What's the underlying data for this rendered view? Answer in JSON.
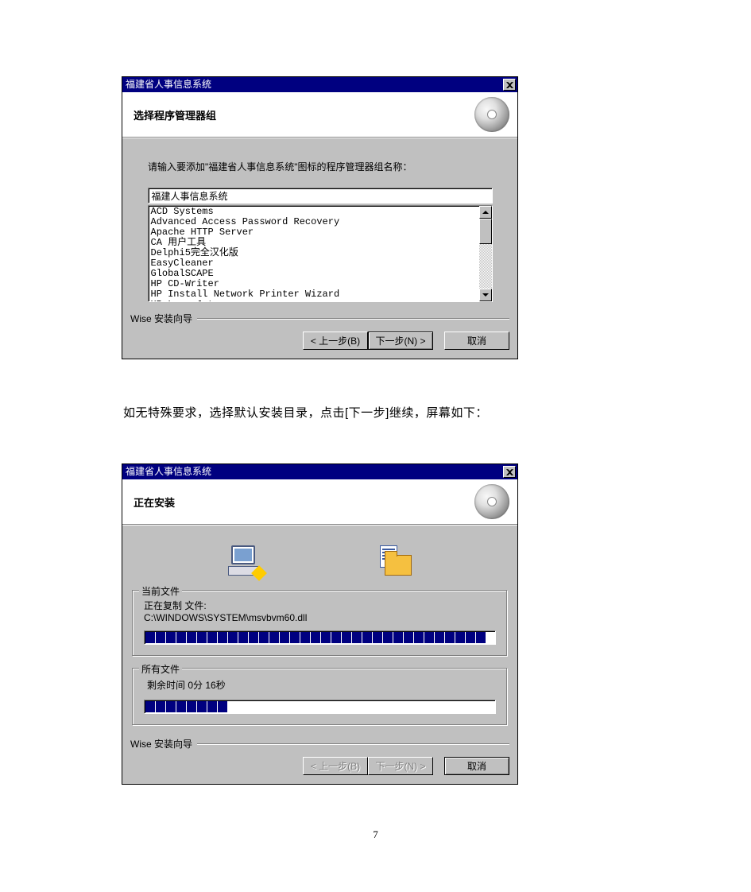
{
  "dialog1": {
    "title": "福建省人事信息系统",
    "header": "选择程序管理器组",
    "instruction": "请输入要添加\"福建省人事信息系统\"图标的程序管理器组名称：",
    "input_value": "福建人事信息系统",
    "list": [
      "ACD Systems",
      "Advanced Access Password Recovery",
      "Apache HTTP Server",
      "CA 用户工具",
      "Delphi5完全汉化版",
      "EasyCleaner",
      "GlobalSCAPE",
      "HP CD-Writer",
      "HP Install Network Printer Wizard",
      "HP LaserJet"
    ],
    "wizard_label": "Wise 安装向导",
    "buttons": {
      "back": "< 上一步(B)",
      "next": "下一步(N) >",
      "cancel": "取消"
    }
  },
  "narrative": "如无特殊要求，选择默认安装目录，点击[下一步]继续，屏幕如下：",
  "dialog2": {
    "title": "福建省人事信息系统",
    "header": "正在安装",
    "current_group": "当前文件",
    "copying_label": "正在复制 文件:",
    "copying_path": "C:\\WINDOWS\\SYSTEM\\msvbvm60.dll",
    "all_group": "所有文件",
    "remaining": "剩余时间 0分 16秒",
    "wizard_label": "Wise 安装向导",
    "buttons": {
      "back": "< 上一步(B)",
      "next": "下一步(N) >",
      "cancel": "取消"
    },
    "progress1_segments": 33,
    "progress2_segments": 8
  },
  "page_number": "7"
}
